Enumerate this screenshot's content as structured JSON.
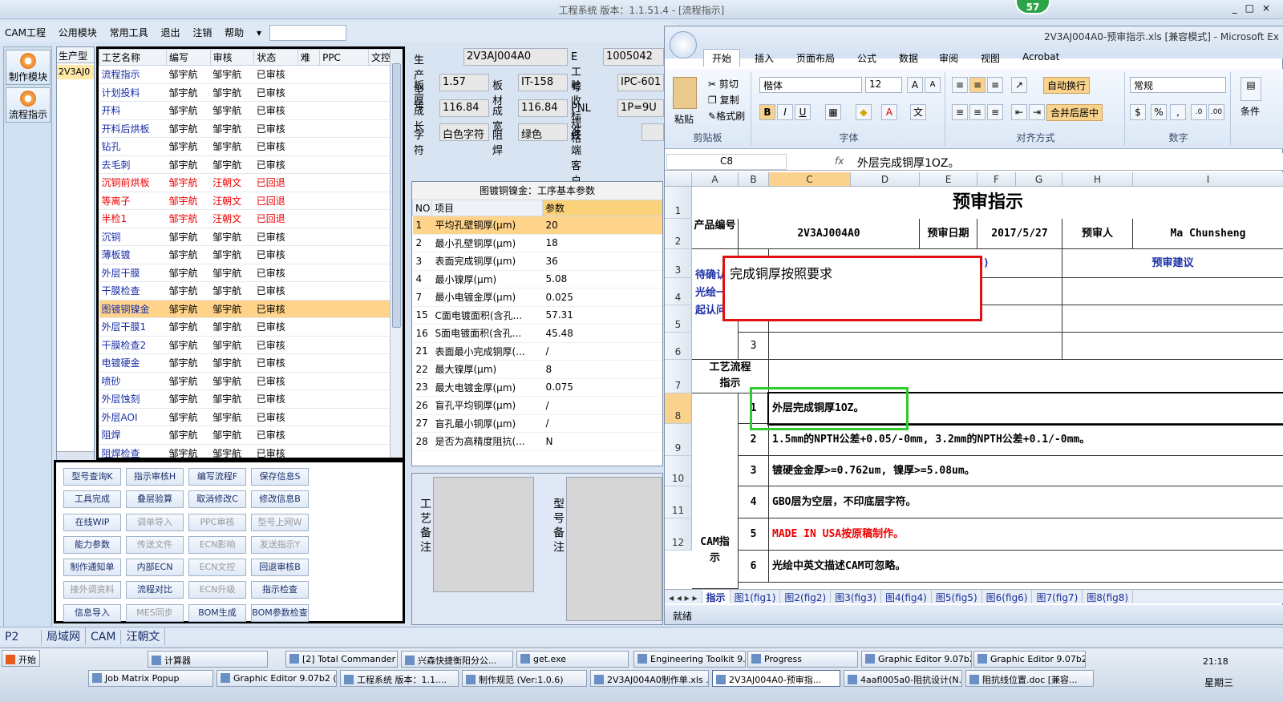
{
  "app": {
    "title": "工程系统  版本：1.1.51.4 - [流程指示]",
    "badge": "57",
    "window_controls": [
      "_",
      "□",
      "×"
    ]
  },
  "menu": [
    "CAM工程",
    "公用模块",
    "常用工具",
    "退出",
    "注销",
    "帮助",
    "▾"
  ],
  "left_modules": [
    {
      "label": "制作模块"
    },
    {
      "label": "流程指示"
    }
  ],
  "product_col": {
    "header": "生产型",
    "item": "2V3AJ0"
  },
  "process_table": {
    "headers": [
      "工艺名称",
      "编写",
      "审核",
      "状态",
      "难",
      "PPC",
      "文控"
    ],
    "rows": [
      [
        "流程指示",
        "邹宇航",
        "邹宇航",
        "已审核"
      ],
      [
        "计划投料",
        "邹宇航",
        "邹宇航",
        "已审核"
      ],
      [
        "开料",
        "邹宇航",
        "邹宇航",
        "已审核"
      ],
      [
        "开料后烘板",
        "邹宇航",
        "邹宇航",
        "已审核"
      ],
      [
        "钻孔",
        "邹宇航",
        "邹宇航",
        "已审核"
      ],
      [
        "去毛刺",
        "邹宇航",
        "邹宇航",
        "已审核"
      ],
      [
        "沉铜前烘板",
        "邹宇航",
        "汪朝文",
        "已回退"
      ],
      [
        "等离子",
        "邹宇航",
        "汪朝文",
        "已回退"
      ],
      [
        "半检1",
        "邹宇航",
        "汪朝文",
        "已回退"
      ],
      [
        "沉铜",
        "邹宇航",
        "邹宇航",
        "已审核"
      ],
      [
        "薄板镀",
        "邹宇航",
        "邹宇航",
        "已审核"
      ],
      [
        "外层干膜",
        "邹宇航",
        "邹宇航",
        "已审核"
      ],
      [
        "干膜检查",
        "邹宇航",
        "邹宇航",
        "已审核"
      ],
      [
        "图镀铜镍金",
        "邹宇航",
        "邹宇航",
        "已审核"
      ],
      [
        "外层干膜1",
        "邹宇航",
        "邹宇航",
        "已审核"
      ],
      [
        "干膜检查2",
        "邹宇航",
        "邹宇航",
        "已审核"
      ],
      [
        "电镀硬金",
        "邹宇航",
        "邹宇航",
        "已审核"
      ],
      [
        "喷砂",
        "邹宇航",
        "邹宇航",
        "已审核"
      ],
      [
        "外层蚀刻",
        "邹宇航",
        "邹宇航",
        "已审核"
      ],
      [
        "外层AOI",
        "邹宇航",
        "邹宇航",
        "已审核"
      ],
      [
        "阻焊",
        "邹宇航",
        "邹宇航",
        "已审核"
      ],
      [
        "阻焊检查",
        "邹宇航",
        "邹宇航",
        "已审核"
      ]
    ]
  },
  "buttons": [
    {
      "l": "型号查询K",
      "d": false
    },
    {
      "l": "指示审核H",
      "d": false
    },
    {
      "l": "编写流程F",
      "d": false
    },
    {
      "l": "保存信息S",
      "d": false
    },
    {
      "l": "工具完成",
      "d": false
    },
    {
      "l": "叠层验算",
      "d": false
    },
    {
      "l": "取消修改C",
      "d": false
    },
    {
      "l": "修改信息B",
      "d": false
    },
    {
      "l": "在线WIP",
      "d": false
    },
    {
      "l": "调单导入",
      "d": true
    },
    {
      "l": "PPC审核",
      "d": true
    },
    {
      "l": "型号上网W",
      "d": true
    },
    {
      "l": "能力参数",
      "d": false
    },
    {
      "l": "传送文件",
      "d": true
    },
    {
      "l": "ECN影响",
      "d": true
    },
    {
      "l": "发送指示Y",
      "d": true
    },
    {
      "l": "制作通知单",
      "d": false
    },
    {
      "l": "内部ECN",
      "d": false
    },
    {
      "l": "ECN文控",
      "d": true
    },
    {
      "l": "回退审核B",
      "d": false
    },
    {
      "l": "接外调资料",
      "d": true
    },
    {
      "l": "流程对比",
      "d": false
    },
    {
      "l": "ECN升级",
      "d": true
    },
    {
      "l": "指示检查",
      "d": false
    },
    {
      "l": "信息导入",
      "d": false
    },
    {
      "l": "MES同步",
      "d": true
    },
    {
      "l": "BOM生成",
      "d": false
    },
    {
      "l": "BOM参数检查",
      "d": false
    }
  ],
  "info": {
    "prod_model_label": "生产型号",
    "prod_model": "2V3AJ004A0",
    "e_no_label": "E工号",
    "e_no": "1005042",
    "thick_label": "板厚",
    "thick": "1.57",
    "material_label": "板材",
    "material": "IT-158",
    "accept_label": "验收标准",
    "accept": "IPC-601",
    "length_label": "成长",
    "length": "116.84",
    "width_label": "成宽",
    "width": "116.84",
    "pnl_label": "PNL规格",
    "pnl": "1P=9U",
    "char_label": "字符",
    "char": "白色字符",
    "mask_label": "阻焊",
    "mask": "绿色",
    "customer_label": "终端客户代码"
  },
  "params": {
    "caption": "图镀铜镍金：工序基本参数",
    "headers": [
      "NO",
      "项目",
      "参数"
    ],
    "rows": [
      [
        "1",
        "平均孔壁铜厚(μm)",
        "20"
      ],
      [
        "2",
        "最小孔壁铜厚(μm)",
        "18"
      ],
      [
        "3",
        "表面完成铜厚(μm)",
        "36"
      ],
      [
        "4",
        "最小镍厚(μm)",
        "5.08"
      ],
      [
        "7",
        "最小电镀金厚(μm)",
        "0.025"
      ],
      [
        "15",
        "C面电镀面积(含孔...",
        "57.31"
      ],
      [
        "16",
        "S面电镀面积(含孔...",
        "45.48"
      ],
      [
        "21",
        "表面最小完成铜厚(...",
        "/"
      ],
      [
        "22",
        "最大镍厚(μm)",
        "8"
      ],
      [
        "23",
        "最大电镀金厚(μm)",
        "0.075"
      ],
      [
        "26",
        "盲孔平均铜厚(μm)",
        "/"
      ],
      [
        "27",
        "盲孔最小铜厚(μm)",
        "/"
      ],
      [
        "28",
        "是否为高精度阻抗(...",
        "N"
      ]
    ]
  },
  "notes": {
    "process": "工艺备注",
    "model": "型号备注"
  },
  "excel": {
    "title": "2V3AJ004A0-预审指示.xls [兼容模式] - Microsoft Ex",
    "tabs": [
      "开始",
      "插入",
      "页面布局",
      "公式",
      "数据",
      "审阅",
      "视图",
      "Acrobat"
    ],
    "clipboard": {
      "paste": "粘贴",
      "cut": "剪切",
      "copy": "复制",
      "format": "格式刷",
      "group": "剪贴板"
    },
    "font": {
      "name": "楷体",
      "size": "12",
      "group": "字体"
    },
    "align": {
      "wrap": "自动换行",
      "merge": "合并后居中",
      "group": "对齐方式"
    },
    "number": {
      "format": "常规",
      "group": "数字"
    },
    "styles": {
      "cond": "条件"
    },
    "namebox": "C8",
    "fx": "fx",
    "formula": "外层完成铜厚1OZ。",
    "cols": [
      "A",
      "B",
      "C",
      "D",
      "E",
      "F",
      "G",
      "H",
      "I"
    ],
    "rows": [
      "1",
      "2",
      "3",
      "4",
      "5",
      "6",
      "7",
      "8",
      "9",
      "10",
      "11",
      "12"
    ],
    "sheet_title": "预审指示",
    "prod_label": "产品编号",
    "prod_val": "2V3AJ004A0",
    "date_label": "预审日期",
    "date_val": "2017/5/27",
    "reviewer_label": "预审人",
    "reviewer_val": "Ma Chunsheng",
    "seq_label": "序号",
    "issue_header": "待与客户确认问题(原因与内容)",
    "suggest_header": "预审建议",
    "pending_label": "待确认光绘一起认问",
    "row3_num": "3",
    "flow_label": "工艺流程指示",
    "cam_label": "CAM指示",
    "lines": [
      {
        "n": "1",
        "t": "外层完成铜厚1OZ。",
        "red": false
      },
      {
        "n": "2",
        "t": "1.5mm的NPTH公差+0.05/-0mm, 3.2mm的NPTH公差+0.1/-0mm。",
        "red": false
      },
      {
        "n": "3",
        "t": "镀硬金金厚>=0.762um, 镍厚>=5.08um。",
        "red": false
      },
      {
        "n": "4",
        "t": "GBO层为空层，不印底层字符。",
        "red": false
      },
      {
        "n": "5",
        "t": "MADE IN USA按原稿制作。",
        "red": true
      },
      {
        "n": "6",
        "t": "光绘中英文描述CAM可忽略。",
        "red": false
      }
    ],
    "callout": "完成铜厚按照要求",
    "sheets": [
      "指示",
      "图1(fig1)",
      "图2(fig2)",
      "图3(fig3)",
      "图4(fig4)",
      "图5(fig5)",
      "图6(fig6)",
      "图7(fig7)",
      "图8(fig8)"
    ],
    "status": "就绪"
  },
  "bottom_bar": [
    "P2",
    "局域网",
    "CAM",
    "汪朝文"
  ],
  "taskbar": {
    "start": "开始",
    "row1": [
      "计算器",
      "[2] Total Commander ...",
      "兴森快捷衡阳分公...",
      "get.exe",
      "Engineering Toolkit 9....",
      "Progress",
      "Graphic Editor 9.07b2...",
      "Graphic Editor 9.07b2..."
    ],
    "row2": [
      "Job Matrix Popup",
      "Graphic Editor 9.07b2 (0...",
      "工程系统  版本：1.1....",
      "制作规范 (Ver:1.0.6)",
      "2V3AJ004A0制作单.xls ...",
      "2V3AJ004A0-预审指...",
      "4aafl005a0-阻抗设计(N...",
      "阻抗线位置.doc [兼容..."
    ],
    "time": "21:18",
    "day": "星期三"
  }
}
